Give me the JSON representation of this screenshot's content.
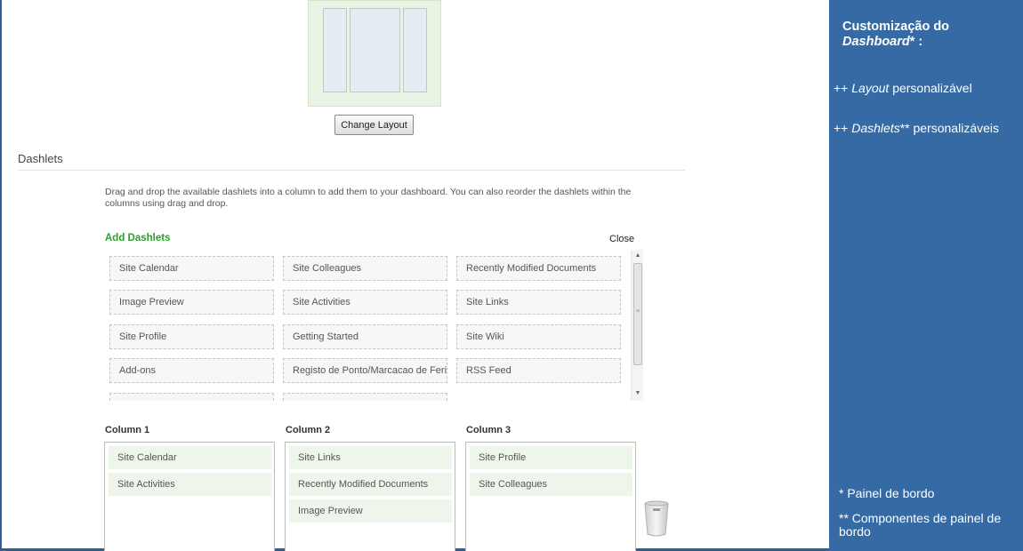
{
  "dashlets_section": {
    "title": "Dashlets",
    "instructions": "Drag and drop the available dashlets into a column to add them to your dashboard. You can also reorder the dashlets within the columns using drag and drop."
  },
  "layout": {
    "change_button": "Change Layout"
  },
  "add_dashlets": {
    "title": "Add Dashlets",
    "close_label": "Close",
    "items": [
      "Site Calendar",
      "Site Colleagues",
      "Recently Modified Documents",
      "Image Preview",
      "Site Activities",
      "Site Links",
      "Site Profile",
      "Getting Started",
      "Site Wiki",
      "Add-ons",
      "Registo de Ponto/Marcacao de Ferias",
      "RSS Feed"
    ]
  },
  "columns": [
    {
      "title": "Column 1",
      "items": [
        "Site Calendar",
        "Site Activities"
      ]
    },
    {
      "title": "Column 2",
      "items": [
        "Site Links",
        "Recently Modified Documents",
        "Image Preview"
      ]
    },
    {
      "title": "Column 3",
      "items": [
        "Site Profile",
        "Site Colleagues"
      ]
    }
  ],
  "side_panel": {
    "title_line1": "Customização do",
    "title_italic": "Dashboard",
    "title_suffix": "* :",
    "line1_prefix": "++",
    "line1_italic": "Layout",
    "line1_rest": "personalizável",
    "line2_prefix": "++",
    "line2_italic": "Dashlets",
    "line2_rest": "** personalizáveis",
    "footnote1": "* Painel de bordo",
    "footnote2": "** Componentes de painel de bordo"
  },
  "colors": {
    "panel_bg": "#356aa5",
    "add_title": "#2aa12a",
    "item_bg": "#eef5ea"
  },
  "icons": [
    "trash-icon",
    "scroll-up-icon",
    "scroll-down-icon"
  ]
}
